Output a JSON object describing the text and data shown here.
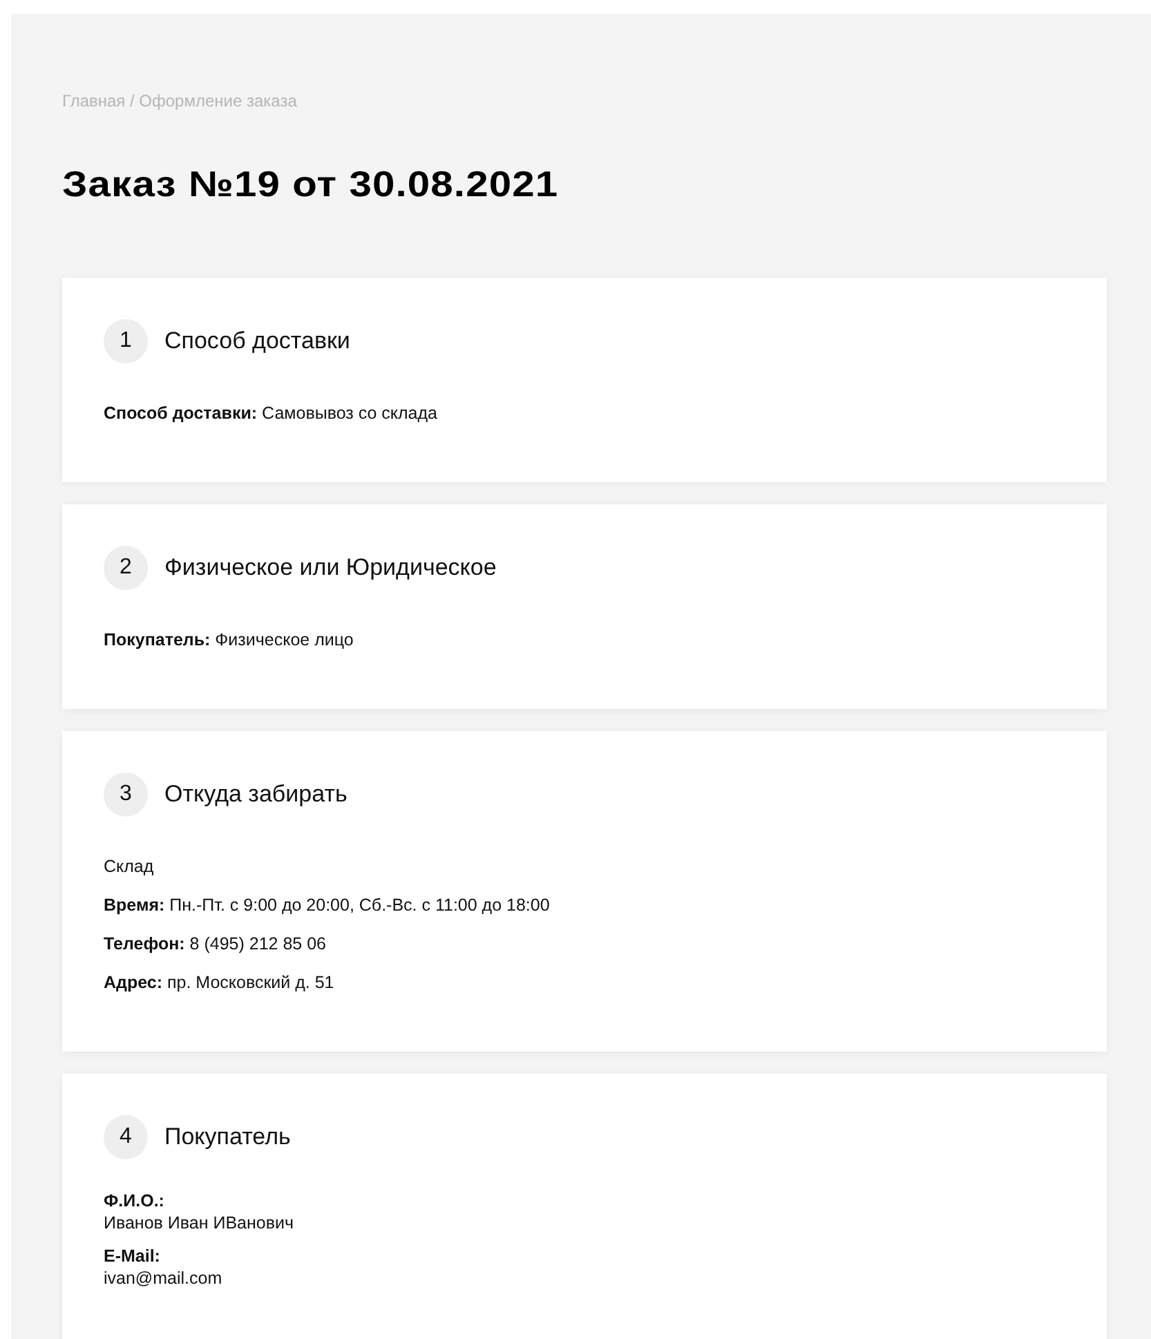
{
  "breadcrumb": "Главная / Оформление заказа",
  "title": "Заказ №19 от 30.08.2021",
  "sections": [
    {
      "number": "1",
      "title": "Способ доставки",
      "lines": [
        {
          "kind": "inline",
          "text": "**Способ доставки:** Самовывоз со склада"
        }
      ]
    },
    {
      "number": "2",
      "title": "Физическое или Юридическое",
      "lines": [
        {
          "kind": "inline",
          "text": "**Покупатель:** Физическое лицо"
        }
      ]
    },
    {
      "number": "3",
      "title": "Откуда забирать",
      "lines": [
        {
          "kind": "inline",
          "text": "Склад"
        },
        {
          "kind": "inline",
          "text": "**Время:** Пн.-Пт. с 9:00 до 20:00, Сб.-Вс. с 11:00 до 18:00"
        },
        {
          "kind": "inline",
          "text": "**Телефон:** 8 (495) 212 85 06"
        },
        {
          "kind": "inline",
          "text": "**Адрес:** пр. Московский д. 51"
        }
      ]
    },
    {
      "number": "4",
      "title": "Покупатель",
      "lines": [
        {
          "kind": "stacked",
          "label": "Ф.И.О.:",
          "value": "Иванов Иван ИВанович"
        },
        {
          "kind": "stacked",
          "label": "E-Mail:",
          "value": "ivan@mail.com"
        }
      ]
    }
  ]
}
